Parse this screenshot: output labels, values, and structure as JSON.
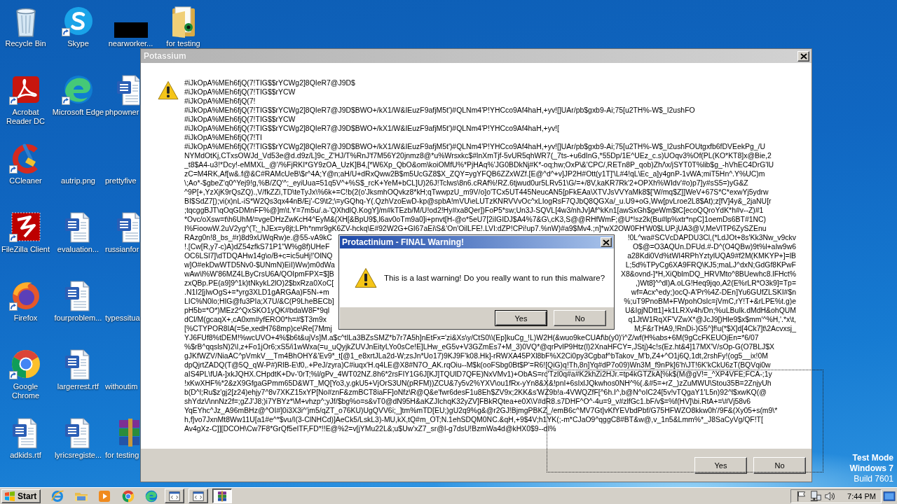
{
  "desktop": {
    "columns": [
      [
        {
          "label": "Recycle Bin",
          "shortcut": false
        },
        {
          "label": "Acrobat Reader DC",
          "shortcut": true
        },
        {
          "label": "CCleaner",
          "shortcut": true
        },
        {
          "label": "FileZilla Client",
          "shortcut": true
        },
        {
          "label": "Firefox",
          "shortcut": true
        },
        {
          "label": "Google Chrome",
          "shortcut": true
        },
        {
          "label": "adkids.rtf",
          "shortcut": false
        }
      ],
      [
        {
          "label": "Skype",
          "shortcut": true
        },
        {
          "label": "Microsoft Edge",
          "shortcut": true
        },
        {
          "label": "autrip.png",
          "shortcut": false
        },
        {
          "label": "evaluation...",
          "shortcut": false
        },
        {
          "label": "fourproblem...",
          "shortcut": false
        },
        {
          "label": "largerrest.rtf",
          "shortcut": false
        },
        {
          "label": "lyricsregiste...",
          "shortcut": false
        }
      ],
      [
        {
          "label": "nearworker...",
          "shortcut": false
        },
        {
          "label": "phpowner",
          "shortcut": false
        },
        {
          "label": "prettyfive",
          "shortcut": false
        },
        {
          "label": "russianfor",
          "shortcut": false
        },
        {
          "label": "typessitua",
          "shortcut": false
        },
        {
          "label": "withoutim",
          "shortcut": false
        },
        {
          "label": "for testing",
          "shortcut": false
        }
      ],
      [
        {
          "label": "for testing",
          "shortcut": false
        }
      ]
    ]
  },
  "main_window": {
    "title": "Potassium",
    "lines": [
      [
        "#iJkOpA%MEh6fjQ(7!TIG$$rYCWg2]8QIeR7@J9D$"
      ],
      [
        "#iJkOpA%MEh6fjQ(7!TIG$$rYCW"
      ],
      [
        "#iJkOpA%MEh6fjQ(7!"
      ],
      [
        "#iJkOpA%MEh6fjQ(7!TIG$$rYCWg2]8QIeR7@J9D$BWO+/kX1/W&IEuzF9afjM5t')#QLNm4'P!YHCco9Af4haH,+yv![]UAr/pb$gxb9-Ai;75[u2TH%-W$_I2ushFO"
      ],
      [
        "#iJkOpA%MEh6fjQ(7!TIG$$rYCW"
      ],
      [
        "#iJkOpA%MEh6fjQ(7!TIG$$rYCWg2]8QIeR7@J9D$BWO+/kX1/W&IEuzF9afjM5t')#QLNm4'P!YHCco9Af4haH,+yv!["
      ],
      [
        "#iJkOpA%MEh6fjQ(7!TI"
      ],
      [
        "#iJkOpA%MEh6fjQ(7!TIG$$rYCWg2]8QIeR7@J9D$BWO+/kX1/W&IEuzF9afjM5t')#QLNm4'P!YHCco9Af4haH,+yv![]UAr/pb$gxb9-Ai;75[u2TH%-W$_I2ushFOUtgxfb6fDVEekPg_/U"
      ],
      [
        "NYMdOtKj,CTxsOWJd_Vd53e@d.d9z/L]9c_Z'HJ/T%RnJ'f7M56Y20jnmz8@*u%Wrsxkc$#lnXmTjf-5vUR5qhWR7(_7ts-+u6dInG,*55Dp/1E^UEz_c.s)UOqv3%Of(PL(KO*KT8]x@Bie,2"
      ],
      [
        "_t8$A4-u3!*Dcy!-eMMXL_@'/%FjRKI*GY9zOA_UzK]B4,[*W6Xp_QbO&om\\koiOMfU%*PjHAq%'JG0BDkNj#K*-oq;hw;OxP\\&'CPC/,RETn8P_qob)Zh/\\x/jSYT0T%lib$g_-hVhEC4DrG'lU"
      ],
      [
        "zC=M4RK,Af[w&.f@&C#RAMcUeB\\$r^4A;Y@n;aH/U+dRxQww2B$m5UcGZ8$X_ZQY=ygYFQB6ZZxWZf.[E@^d^+v]JP2H#Ott(y1T]'\\L#4!qL\\Ec_a]y4gnP-1vWA;miT5Hn^.Y%UC)m"
      ],
      [
        "\\;Ao*-$gbeZ'q0^Yej9!g,%B/ZQ'^;_eyiUua=51q5V^+%S$_rcK+YeM+bCL]U)26J!Tclws\\8n6.cRAf%!RZ.6tjwud0ur5LRv51\\G/=+/8V,kaKR7Rk'2+OPXh%WIdv'#o)p7]y#sS5=)yG&Z"
      ],
      [
        "^9P[+,YzXjK9rQsZQ).,V/fkZZi,TD\\teTyJx\\%6k+=C!b(2(o'JksmhOQvkz8*kH;qTwwpzU_m9V/o]o'TCx5UT445NeucAN5[pFkEAa\\XTVJsVVYaMk8$['W/mq$Z]]WeV+67S*C*exwYj5ydrw"
      ],
      [
        "BI$SdZ7[);vi(x)nL-iS*W2Qs3qx44nB/Ej'-C9\\t2;\\=yGQhq-Y(.QzhVzoEwD-kp@spbA!mVU\\eLUTzKNRVVvOc^xLIogRsF7QJbQ8QGXa/_u.U9+oG,Ww[pvLroe2L8$At);z[fV]4y&_2jaNU[r"
      ],
      [
        ";tqcggBJT\\qOqGDMnFF%@]m\\t.Y=7m5u/.a-'QXhdlQ.KogY]/m#kTEzb/M/U!od2!Hy#xa8Qer])FoP5*sw;Un3J-SQVL[4w3/nhJv]Af^kKn1[awSxGh$geWm$tC[ecoQQroYdK*h#v--Z)#1"
      ],
      [
        "*Ovc/oXsw=t\\h6UhM/=vgeDHzZwKcH4^EyM&(XH[&BpU9$,l6av0oTm9a0]i+pnvt[H-@o*5eU7[2iIGIDJ$A4%7&G\\,cK3,S@@RHfWmF;@U*!sz2k(Bu#lp%xtr*npC]1oemDs6BT#1NC)"
      ],
      [
        "I%FioowW.2uV2yg^(T;_hJEx=y8jt;LPh*nmr9gK6ZV-hckq\\E#92W2G+GI67aEi\\S&'On'OilLFE!.LVI:dZP!CPi!up7.%nW)#a9$Mv4.;n]*wX2OW0FH'W0$LUP.jUA3@V,MeVlTP6ZySZEnu"
      ],
      [
        "RAzg0n!8_bs_#r)8d9xUWqRw)e.@55-vA9kC",
        "!0L^wa#SCVcDAPDU3Cl,(*LdJOt+8s'Kk3Nw_v9ckv"
      ],
      [
        "!.[Cw[R,y7-c)A)dZ54zfkS71P1\"W%g8f)UHeF",
        "O$@=O3AQUn.DFUd.#-D^(O4QBw)9t%l+aIw9w6"
      ],
      [
        "OC6LSl7]\\dTDQAHw14g\\o/B+c=ic5uHj!'OlNQ",
        "a28Kdi0Vd%tWI4RPhYztylUQA9#f2M(KMKYP+]=lB"
      ],
      [
        "w]O#ekDwWTD5Nv0-$UNmN)EiI)Ww)m0dWa",
        "L;5d%TPyCg6XA9FRQ\\KJ5;maLJ^dxN;GdGf8KPwF"
      ],
      [
        "wAw\\l%W'86MZ4LByCrsU6A/QOIpmFPX=$]B",
        "X8&ovnd-]*H,XiQblmDQ_HRVMto^8BUewhc8.lFHct%"
      ],
      [
        "zxQBp.PE(a9]9^1k)tNkykL2lO)2$bxRza0XoC[",
        ",)Wt8]^^dl)A.oLG!Heq9jqo,A2(E%rLR*O3k9]=Tp="
      ],
      [
        ".N1I2[jIwOgS+=*yrg3XLD1gARGAa)F5N-+m",
        "wf=Acx^edy;)ocQ-A'Pr%4Z-DEn]Yu6GUfZLSKI#$n"
      ],
      [
        "LIC%N0lo;HIG@fu3PIa;X7U/&C(P9LheBECb]",
        "%;uT9PnoBM+FWpohOslc=jVmC,rY!T+&rLPE%t.g)e"
      ],
      [
        "pH5b=*O*)MEz2^QxSKO1yQK#bdaW8F*9ql",
        "U&IgjNDtt1]+k1LRXv4h/Dn;%uLBuIk.dMdH&ohQUM"
      ],
      [
        "dCl/M(gcaqX+,cA0xm#yfERO0*h=#$T3m9x",
        "q1JtW1RqXF'VZwX*@JcJ9[)Hle9$x$mm'^%H,'.*x\\t,"
      ],
      [
        "[%CTYPOR8IA(=5e,xedH768mp)ce\\Re[7Mmj",
        "M;F&rTHA9,!RnDi-)G5^]f!u(*$X]d[4Ck7]t\\2Acvxsj_"
      ],
      [
        "YJ6FUf8%tDEM!%wcUVO+4%$b6t&ujVs]M.a$c^tILa3BZsSMZ*b7r7A5h]nEtFx='zi&Xs\\y/CtS0\\\\(Ep]kuCg_!L)W2H(&wuo9keCUAf\\b(y0)'i^Z/wf(H%abs+6M(9gCcFKEUOjEn=*6/07"
      ],
      [
        "%$rB^qqslsN)2\\I,z+Fo1jOr6;xS5/i1wWxa(=u_uQyjkZUVJnEityLYo0sCe!E]LHw_eG5v+V3GZmEs7+M_3)0VQ*@qrPvlP9Htz(l)2XnaHFCY=,JStj)4c!s(Ez.ht&4]17MX'V/sOp-G(O7BLJ$X"
      ],
      [
        "gJKfWZV/NiaAC^pVmkV__Tm4BhOHY&'Ev9*_t[@1_e8xrtJLa2d-W;zsJn*Uo17)9KJ9F'k08.Hk]-rRWXA45PXl8bF%X2Ci0py3Cgbaf^bTakov_M'b,Z4+^O1j6Q,1dt,2rshFy!(og5__ix!0M"
      ],
      [
        "dpQjrtZADQ(T@5Q_qW-P#)RlB-E\\f0,.+PeJ/zyra)C#iuqx'H.q4LE@X8#N7O_AK.rqOiu--M$k(ooFSbg0Bt$P'=R6![QiG)q!Th,8n]Yq#dP7o09)Wn3M_f9nPk]6'h\\JT!6K'kCkU6zT(BQVqi0w"
      ],
      [
        "aIS4PL\\fUA-]xkJQHX.CHpdtK+Dv-'0rT;%l/gPv_4WT02NZ.8h6*2rsFIY1G6J[KJ]TQUlD7QFE)NxVMv1)+ObAS=rc'Tzl0q#a#K2khZi2HJr.=tp4kGTZkA[%k$(M@gV!=_^XP4VFE;FCA-;1y"
      ],
      [
        "!xKwXHF%*2&zX9GfgaGPmm65D&WT_MQ[Yo3,y.gkU5+VjOrS3UN(pRFM))ZCU&7y5v2%YXV\\ou1fRx-yYn8&X&!pnI+6sIxlJQkwhos0NH^%(.&#5=+rZ_)zZuMWU\\Stou35B=2ZnjyUh"
      ],
      [
        "b(D^l;Ru$z'gj2[z24)ehjy7^8v7XKZ15xYP[No#znF&zmBCT8iaFF]oNfz\\R@Q&e'fwr6desF1u8Eh$ZV9x;2KK&s'WZ9b!a-4VWQZfF[^6h.I^,b@N^oIC24[5v!vTQgaY1'L5n)92^l$xwKQ(@"
      ],
      [
        "shYdz\\/\\nnNz2f=;gZJ'J8;)i7YBYz*\\M+vhzp^;yJf/$bg%o=s&vT0@dN95H&aKZJIchqK32yZV]FBkRQtea+e0X\\V#dR8.s7DHF^O^-4u=9_v#zlfGc1.bF/v$=%f(HV]\\bi.RtA+=\\#Vj58v6"
      ],
      [
        "YqEYhc^Jz_A96mBHz@^OI#]0i3X3i^'jm5/qZT_o76KU)UgQVV6i;_]tm%mTD[EU;)gU2q9%g&@r2GJ!BjmgPBKZ_/emB6c^MV7Gt]vKfYEVbdPbf/G75HFWZO8kkw0h'/9F&(Xy05+s(m9\\*"
      ],
      [
        "h,f]vo7JxnMt8Ww11U[a1#e^*$vu/I(3-ClNHCd)]AeCk5/LskL3)-MU,kX,tQ#m_OT;N.1ehSDQM0NC.&qH,+9$4V;h1YK(;-m*CJaO9^qggC8#BT&w@,v_1n5&Lmm%*_J8SaCyVg/QF!T["
      ],
      [
        "Av4gXz-C]][DCOH\\Cw7F8*GrQf5eITF,FD*!!E@%2=v[jYMu22L&;u$Uw'xZ7_sr@I-g7dsU!BzmWa4d@kHX0$9--dI%"
      ]
    ],
    "buttons": [
      {
        "label": "Yes"
      },
      {
        "label": "No"
      }
    ]
  },
  "dialog": {
    "title": "Protactinium - FINAL Warning!",
    "message": "This is a last warning! Do you really want to run this malware?",
    "buttons": [
      {
        "label": "Yes",
        "focused": true
      },
      {
        "label": "No",
        "focused": false
      }
    ]
  },
  "system_notice": [
    "Test Mode",
    "Windows 7",
    "Build 7601"
  ],
  "taskbar": {
    "start": "Start",
    "tasks": [
      {
        "selected": false
      },
      {
        "selected": false
      },
      {
        "selected": true
      }
    ],
    "clock": "7:44 PM"
  }
}
